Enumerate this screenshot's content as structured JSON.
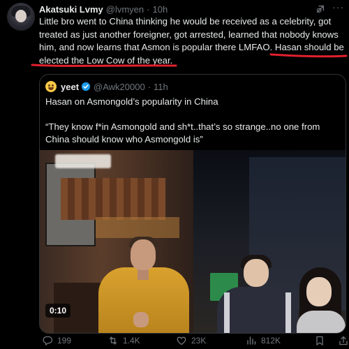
{
  "tweet": {
    "author_name": "Akatsuki Lvmy",
    "author_handle": "@lvmyen",
    "separator": "·",
    "time": "10h",
    "text_lines": [
      "Little bro went to China thinking he would be received as a celebrity, got",
      "treated as just another foreigner, got arrested, learned that nobody knows",
      "him, and now learns that Asmon is popular there LMFAO. Hasan should be",
      "elected the Low Cow of the year."
    ],
    "icons": {
      "grok": "grok-icon",
      "more": "more-icon"
    }
  },
  "quote": {
    "author_name": "yeet",
    "author_handle": "@Awk20000",
    "separator": "·",
    "time": "11h",
    "text_paragraphs": [
      "Hasan on Asmongold’s popularity in China",
      "“They know f*in Asmongold and sh*t..that’s so strange..no one from China should know who Asmongold is”"
    ],
    "video_duration": "0:10",
    "verified_color": "#1d9bf0"
  },
  "actions": {
    "replies": "199",
    "reposts": "1.4K",
    "likes": "23K",
    "views": "812K"
  },
  "colors": {
    "background": "#000000",
    "text": "#e7e9ea",
    "muted": "#71767b",
    "underline": "#e0202e"
  }
}
